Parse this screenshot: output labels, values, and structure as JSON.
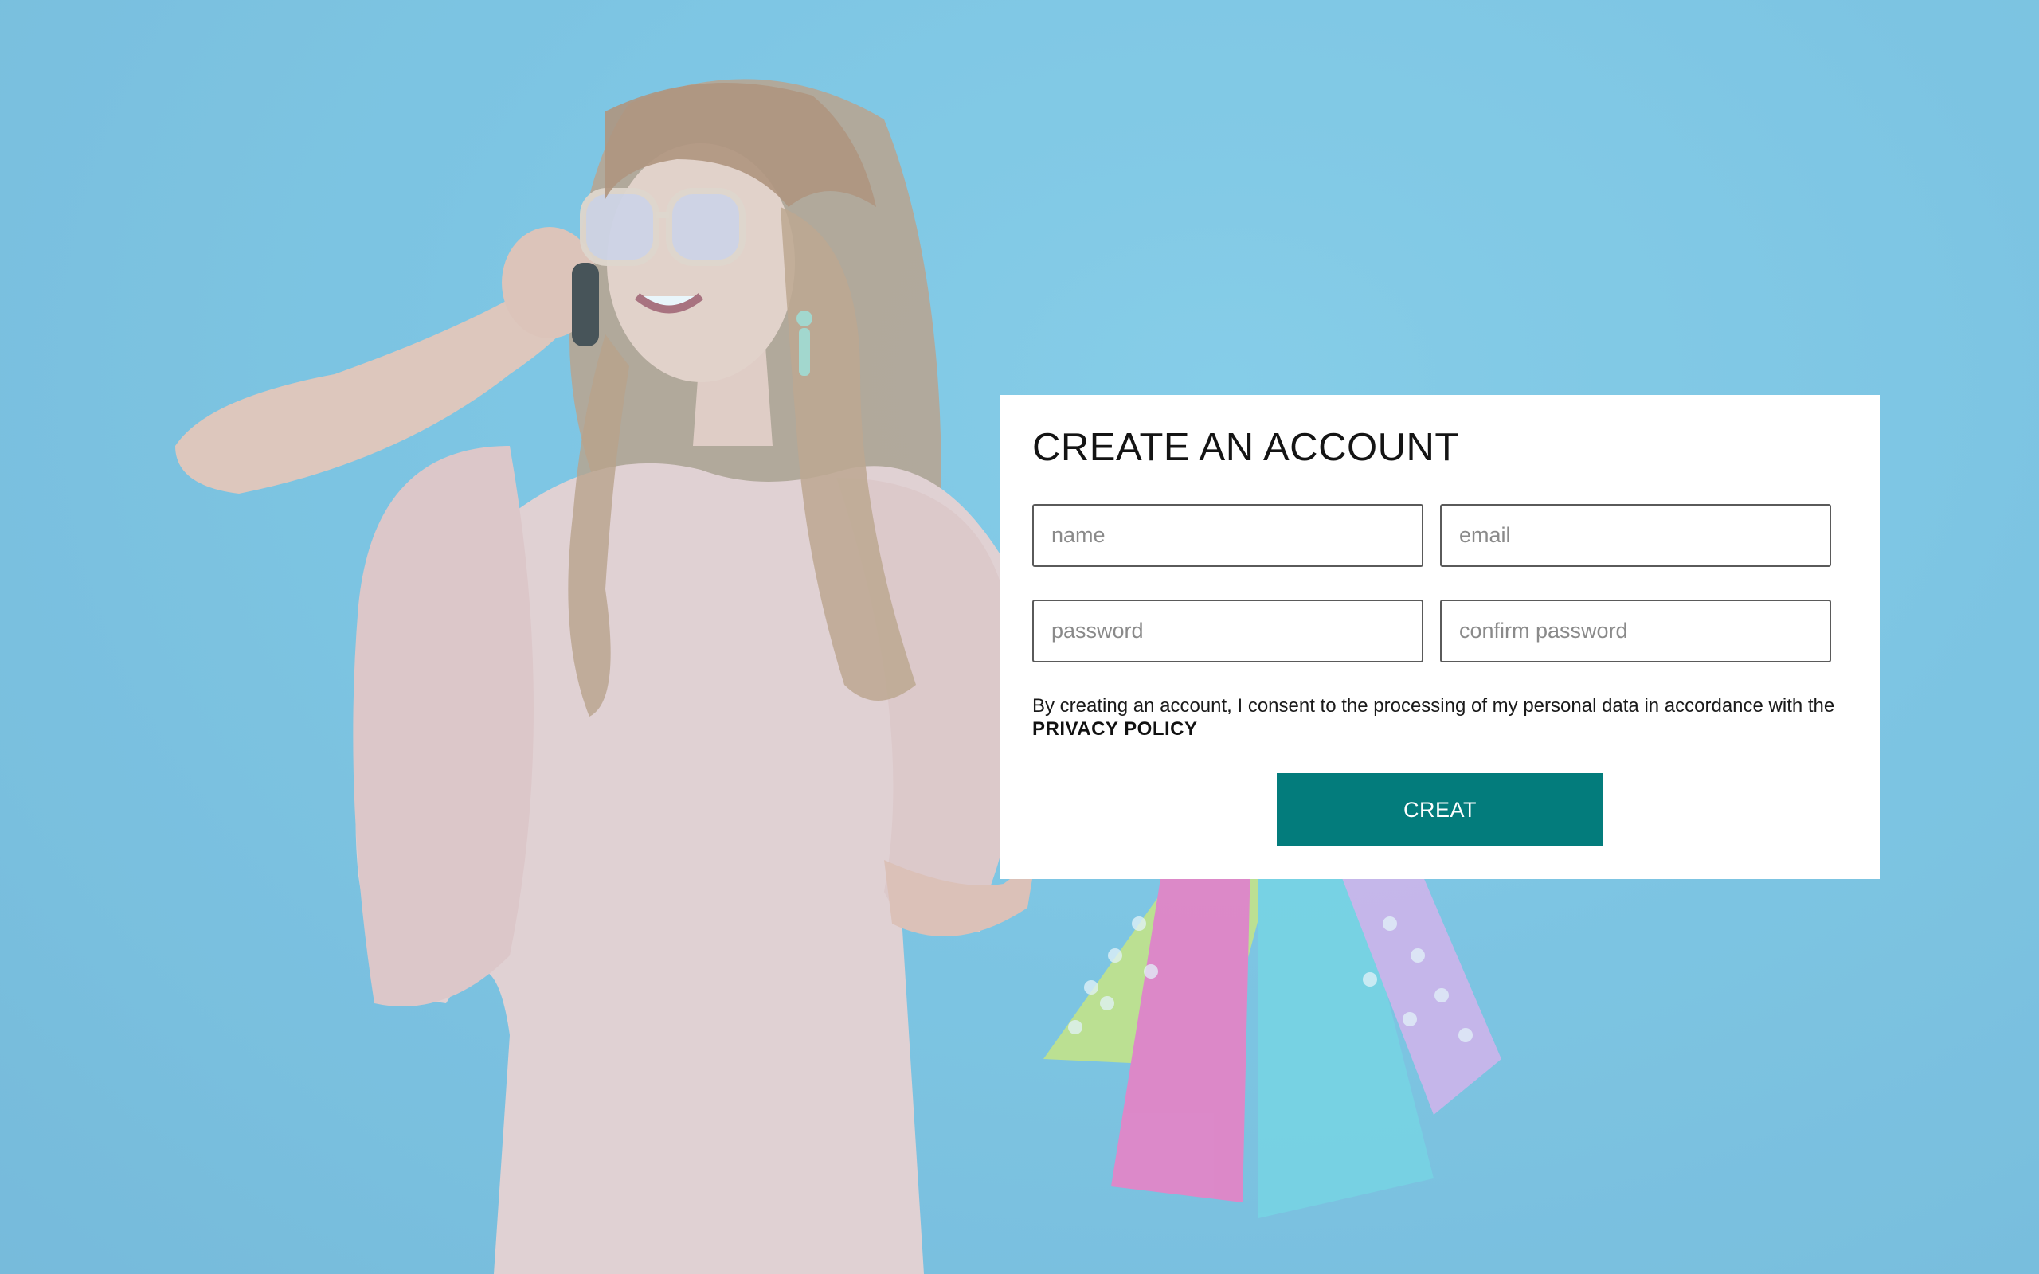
{
  "signup_card": {
    "title": "CREATE AN ACCOUNT",
    "fields": {
      "name_placeholder": "name",
      "email_placeholder": "email",
      "password_placeholder": "password",
      "confirm_password_placeholder": "confirm password"
    },
    "consent_text": "By creating an account, I consent to the processing of my personal data in accordance with the",
    "privacy_link": "PRIVACY POLICY",
    "submit_label": "CREAT"
  },
  "colors": {
    "background": "#7cc4e2",
    "button": "#037c7c",
    "card": "#ffffff"
  }
}
